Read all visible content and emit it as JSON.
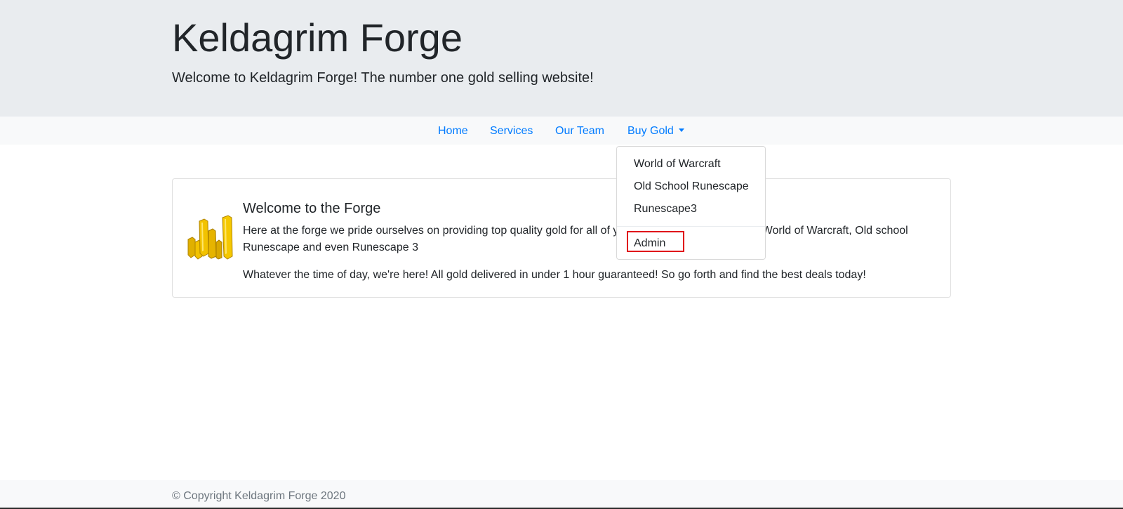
{
  "header": {
    "title": "Keldagrim Forge",
    "subtitle": "Welcome to Keldagrim Forge! The number one gold selling website!"
  },
  "nav": {
    "items": [
      {
        "label": "Home"
      },
      {
        "label": "Services"
      },
      {
        "label": "Our Team"
      },
      {
        "label": "Buy Gold"
      }
    ],
    "dropdown": {
      "items": [
        {
          "label": "World of Warcraft"
        },
        {
          "label": "Old School Runescape"
        },
        {
          "label": "Runescape3"
        }
      ],
      "admin_label": "Admin",
      "highlight_color": "#e0101a"
    }
  },
  "card": {
    "image_icon": "gold-bars-icon",
    "title": "Welcome to the Forge",
    "paragraph_1": "Here at the forge we pride ourselves on providing top quality gold for all of your needs. This ranges from World of Warcraft, Old school Runescape and even Runescape 3",
    "paragraph_2": "Whatever the time of day, we're here! All gold delivered in under 1 hour guaranteed! So go forth and find the best deals today!"
  },
  "footer": {
    "copyright": "© Copyright Keldagrim Forge 2020"
  },
  "colors": {
    "link": "#007bff",
    "jumbotron_bg": "#e9ecef",
    "navbar_bg": "#f8f9fa",
    "gold": "#f2c200"
  }
}
